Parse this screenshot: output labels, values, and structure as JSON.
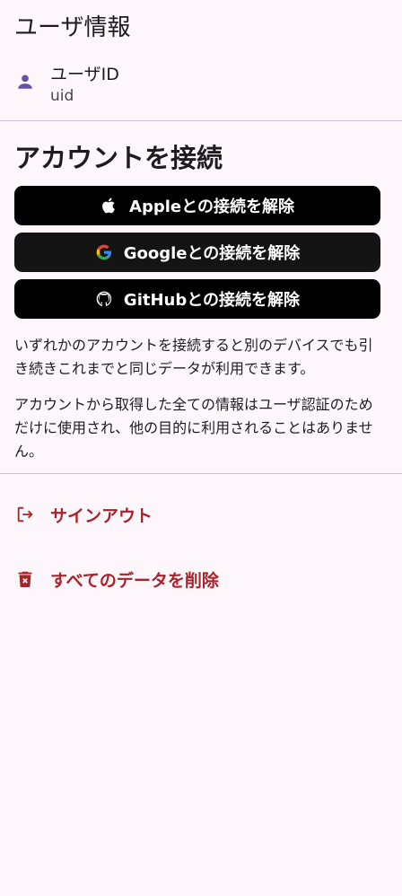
{
  "user_info": {
    "title": "ユーザ情報",
    "user_id_label": "ユーザID",
    "user_id_value": "uid",
    "icon": "person-icon"
  },
  "connect": {
    "title": "アカウントを接続",
    "buttons": [
      {
        "label": "Appleとの接続を解除",
        "icon": "apple-icon"
      },
      {
        "label": "Googleとの接続を解除",
        "icon": "google-icon"
      },
      {
        "label": "GitHubとの接続を解除",
        "icon": "github-icon"
      }
    ],
    "info_1": "いずれかのアカウントを接続すると別のデバイスでも引き続きこれまでと同じデータが利用できます。",
    "info_2": "アカウントから取得した全ての情報はユーザ認証のためだけに使用され、他の目的に利用されることはありません。"
  },
  "actions": {
    "signout_label": "サインアウト",
    "signout_icon": "logout-icon",
    "delete_label": "すべてのデータを削除",
    "delete_icon": "trash-icon"
  },
  "colors": {
    "background": "#fdf7fc",
    "accent": "#6750a4",
    "danger": "#a8232a",
    "button": "#000000"
  }
}
